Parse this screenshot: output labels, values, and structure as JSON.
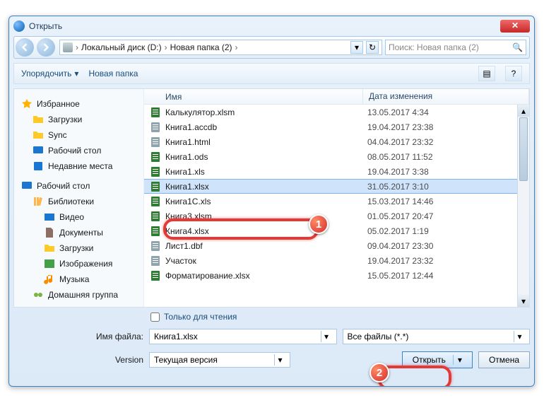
{
  "window": {
    "title": "Открыть"
  },
  "nav": {
    "crumbs": [
      "Локальный диск (D:)",
      "Новая папка (2)"
    ],
    "search_placeholder": "Поиск: Новая папка (2)"
  },
  "toolbar": {
    "organize": "Упорядочить",
    "newfolder": "Новая папка"
  },
  "sidebar": {
    "fav": "Избранное",
    "favitems": [
      "Загрузки",
      "Sync",
      "Рабочий стол",
      "Недавние места"
    ],
    "desk": "Рабочий стол",
    "lib": "Библиотеки",
    "libitems": [
      "Видео",
      "Документы",
      "Загрузки",
      "Изображения",
      "Музыка"
    ],
    "home": "Домашняя группа"
  },
  "columns": {
    "name": "Имя",
    "date": "Дата изменения"
  },
  "files": [
    {
      "n": "Калькулятор.xlsm",
      "d": "13.05.2017 4:34",
      "t": "xls"
    },
    {
      "n": "Книга1.accdb",
      "d": "19.04.2017 23:38",
      "t": "gen"
    },
    {
      "n": "Книга1.html",
      "d": "04.04.2017 23:32",
      "t": "gen"
    },
    {
      "n": "Книга1.ods",
      "d": "08.05.2017 11:52",
      "t": "xls"
    },
    {
      "n": "Книга1.xls",
      "d": "19.04.2017 3:38",
      "t": "xls"
    },
    {
      "n": "Книга1.xlsx",
      "d": "31.05.2017 3:10",
      "t": "xls"
    },
    {
      "n": "Книга1C.xls",
      "d": "15.03.2017 14:46",
      "t": "xls"
    },
    {
      "n": "Книга3.xlsm",
      "d": "01.05.2017 20:47",
      "t": "xls"
    },
    {
      "n": "Книга4.xlsx",
      "d": "05.02.2017 1:19",
      "t": "xls"
    },
    {
      "n": "Лист1.dbf",
      "d": "09.04.2017 23:30",
      "t": "gen"
    },
    {
      "n": "Участок",
      "d": "19.04.2017 23:32",
      "t": "gen"
    },
    {
      "n": "Форматирование.xlsx",
      "d": "15.05.2017 12:44",
      "t": "xls"
    }
  ],
  "selected_index": 5,
  "readonly_label": "Только для чтения",
  "filename_label": "Имя файла:",
  "filename_value": "Книга1.xlsx",
  "filter_value": "Все файлы (*.*)",
  "version_label": "Version",
  "version_value": "Текущая версия",
  "open_label": "Открыть",
  "cancel_label": "Отмена",
  "badges": {
    "b1": "1",
    "b2": "2"
  }
}
